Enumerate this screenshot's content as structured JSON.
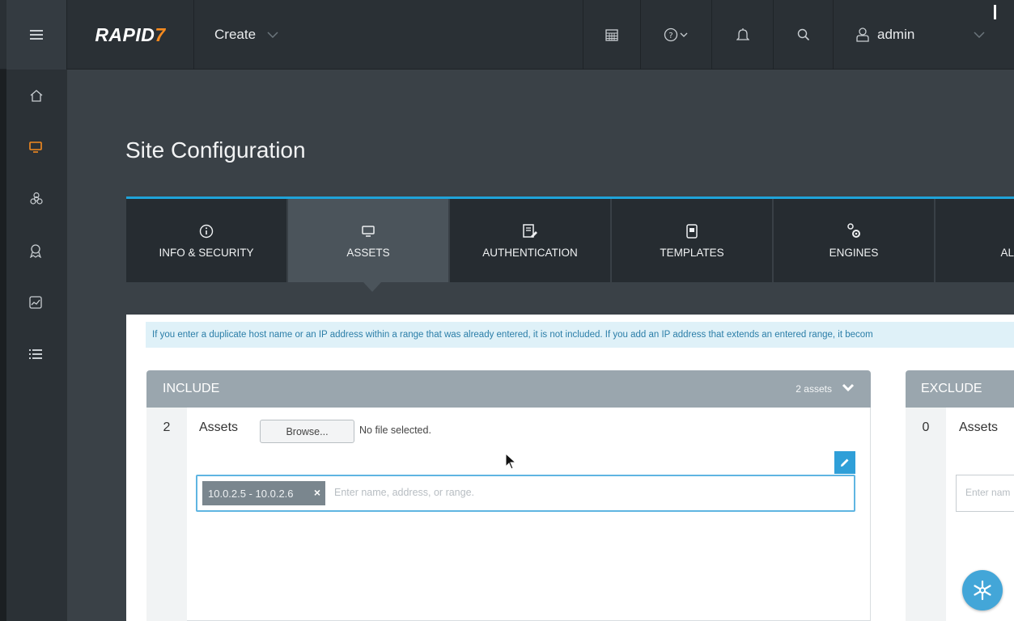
{
  "header": {
    "logo_text": "RAPID",
    "logo_mark": "7",
    "create_label": "Create",
    "user_name": "admin",
    "icons": [
      "menu-icon",
      "chevron-down-icon",
      "calendar-icon",
      "help-icon",
      "bell-icon",
      "search-icon",
      "user-icon"
    ]
  },
  "sidebar": {
    "items": [
      {
        "icon": "home-icon",
        "active": false
      },
      {
        "icon": "monitor-icon",
        "active": true
      },
      {
        "icon": "biohazard-icon",
        "active": false
      },
      {
        "icon": "policy-award-icon",
        "active": false
      },
      {
        "icon": "reports-chart-icon",
        "active": false
      },
      {
        "icon": "list-icon",
        "active": false
      }
    ]
  },
  "page": {
    "title": "Site Configuration"
  },
  "tabs": [
    {
      "label": "INFO & SECURITY",
      "icon": "info-icon",
      "active": false
    },
    {
      "label": "ASSETS",
      "icon": "monitor-icon",
      "active": true
    },
    {
      "label": "AUTHENTICATION",
      "icon": "authentication-icon",
      "active": false
    },
    {
      "label": "TEMPLATES",
      "icon": "template-icon",
      "active": false
    },
    {
      "label": "ENGINES",
      "icon": "gears-icon",
      "active": false
    },
    {
      "label": "AL",
      "icon": "",
      "active": false
    }
  ],
  "info_message": "If you enter a duplicate host name or an IP address within a range that was already entered, it is not included. If you add an IP address that extends an entered range, it becom",
  "include": {
    "title": "INCLUDE",
    "asset_count_label": "2 assets",
    "count": "2",
    "assets_label": "Assets",
    "browse_label": "Browse...",
    "file_status": "No file selected.",
    "chip_label": "10.0.2.5 - 10.0.2.6",
    "chip_remove": "×",
    "input_placeholder": "Enter name, address, or range."
  },
  "exclude": {
    "title": "EXCLUDE",
    "count": "0",
    "assets_label": "Assets",
    "input_placeholder": "Enter nam"
  },
  "colors": {
    "accent": "#1fa3d9",
    "brand_orange": "#f58a1f",
    "topbar": "#2a3035",
    "active_tab": "#4b545b"
  }
}
